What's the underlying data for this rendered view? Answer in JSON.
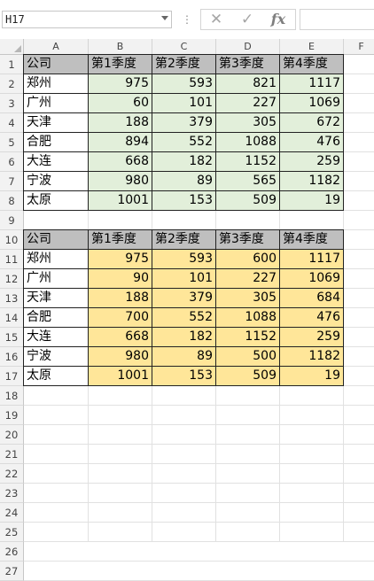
{
  "name_box": "H17",
  "formula_icons": [
    "cancel-icon",
    "enter-icon",
    "function-icon"
  ],
  "function_label": "fx",
  "column_headers": [
    "A",
    "B",
    "C",
    "D",
    "E",
    "F"
  ],
  "row_headers": [
    "1",
    "2",
    "3",
    "4",
    "5",
    "6",
    "7",
    "8",
    "9",
    "10",
    "11",
    "12",
    "13",
    "14",
    "15",
    "16",
    "17",
    "18",
    "19",
    "20",
    "21",
    "22",
    "23",
    "24",
    "25",
    "26",
    "27"
  ],
  "colors": {
    "header_fill": "#bfbfbf",
    "table1_fill": "#e2efda",
    "table2_fill": "#ffe699"
  },
  "table1": {
    "header": [
      "公司",
      "第1季度",
      "第2季度",
      "第3季度",
      "第4季度"
    ],
    "rows": [
      [
        "郑州",
        "975",
        "593",
        "821",
        "1117"
      ],
      [
        "广州",
        "60",
        "101",
        "227",
        "1069"
      ],
      [
        "天津",
        "188",
        "379",
        "305",
        "672"
      ],
      [
        "合肥",
        "894",
        "552",
        "1088",
        "476"
      ],
      [
        "大连",
        "668",
        "182",
        "1152",
        "259"
      ],
      [
        "宁波",
        "980",
        "89",
        "565",
        "1182"
      ],
      [
        "太原",
        "1001",
        "153",
        "509",
        "19"
      ]
    ]
  },
  "table2": {
    "header": [
      "公司",
      "第1季度",
      "第2季度",
      "第3季度",
      "第4季度"
    ],
    "rows": [
      [
        "郑州",
        "975",
        "593",
        "600",
        "1117"
      ],
      [
        "广州",
        "90",
        "101",
        "227",
        "1069"
      ],
      [
        "天津",
        "188",
        "379",
        "305",
        "684"
      ],
      [
        "合肥",
        "700",
        "552",
        "1088",
        "476"
      ],
      [
        "大连",
        "668",
        "182",
        "1152",
        "259"
      ],
      [
        "宁波",
        "980",
        "89",
        "500",
        "1182"
      ],
      [
        "太原",
        "1001",
        "153",
        "509",
        "19"
      ]
    ]
  }
}
